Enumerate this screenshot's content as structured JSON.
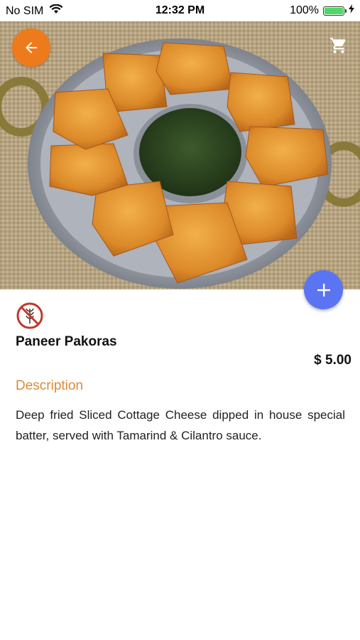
{
  "status_bar": {
    "carrier": "No SIM",
    "time": "12:32 PM",
    "battery_percent": "100%",
    "battery_level": 1.0,
    "battery_color": "#4cd964"
  },
  "header": {
    "back_icon": "arrow-left-icon",
    "cart_icon": "cart-icon",
    "accent_color": "#ed7b1c"
  },
  "fab": {
    "icon": "plus-icon",
    "color": "#5b74f4"
  },
  "item": {
    "diet_icon": "no-wheat-icon",
    "name": "Paneer Pakoras",
    "price": "$ 5.00",
    "description_heading": "Description",
    "description": "Deep fried Sliced Cottage Cheese dipped in house special batter, served with Tamarind & Cilantro sauce."
  }
}
